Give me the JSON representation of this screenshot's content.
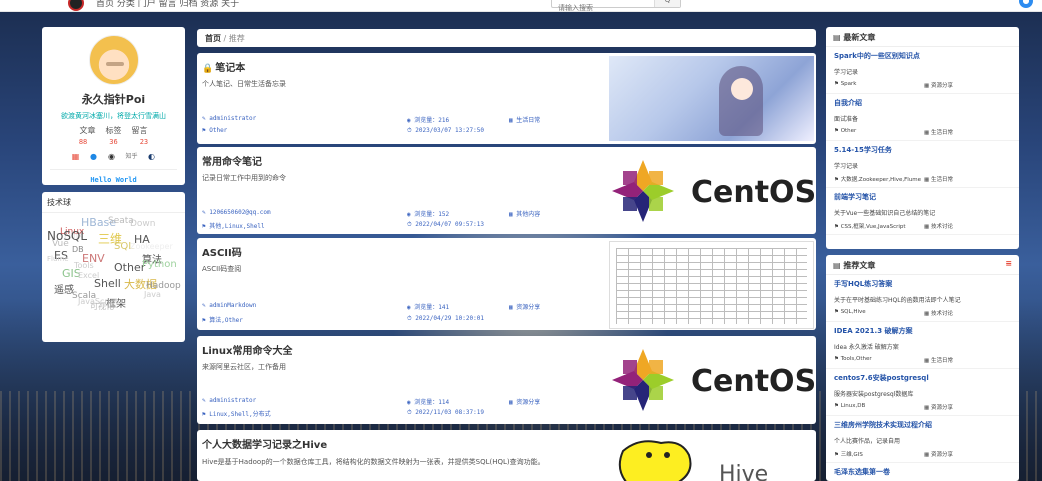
{
  "nav": {
    "items": "首页  分类  门户  留言  归档  资源  关于",
    "search_placeholder": "请输入搜索",
    "search_button": "Q"
  },
  "profile": {
    "name": "永久指针Poi",
    "motto": "欲渡黄河冰塞川，将登太行雪满山",
    "stats_labels": [
      "文章",
      "标签",
      "留言"
    ],
    "stats_values": [
      "88",
      "36",
      "23"
    ],
    "social_icons": [
      "calendar-icon",
      "qq-icon",
      "github-icon",
      "zhihu-icon",
      "steam-icon"
    ],
    "zhihu_label": "知乎",
    "hello": "Hello World"
  },
  "tagcloud": {
    "title": "技术球",
    "tags": [
      {
        "t": "HBase",
        "c": "#9fb7d6",
        "s": 11
      },
      {
        "t": "Seata",
        "c": "#bbb",
        "s": 9
      },
      {
        "t": "Linux",
        "c": "#c55",
        "s": 9
      },
      {
        "t": "Down",
        "c": "#ccc",
        "s": 9
      },
      {
        "t": "Flink",
        "c": "#ddd",
        "s": 8
      },
      {
        "t": "NoSQL",
        "c": "#555",
        "s": 12
      },
      {
        "t": "三维",
        "c": "#e0c84a",
        "s": 12
      },
      {
        "t": "HA",
        "c": "#555",
        "s": 11
      },
      {
        "t": "Vue",
        "c": "#bbb",
        "s": 9
      },
      {
        "t": "SQL",
        "c": "#d8c86a",
        "s": 10
      },
      {
        "t": "Zookeeper",
        "c": "#eee",
        "s": 8
      },
      {
        "t": "ES",
        "c": "#555",
        "s": 11
      },
      {
        "t": "DB",
        "c": "#888",
        "s": 8
      },
      {
        "t": "ENV",
        "c": "#c77",
        "s": 11
      },
      {
        "t": "算法",
        "c": "#555",
        "s": 10
      },
      {
        "t": "Tools",
        "c": "#ccc",
        "s": 8
      },
      {
        "t": "Flume",
        "c": "#ccc",
        "s": 7
      },
      {
        "t": "Other",
        "c": "#555",
        "s": 11
      },
      {
        "t": "Python",
        "c": "#9fd29f",
        "s": 10
      },
      {
        "t": "GIS",
        "c": "#8bc38b",
        "s": 11
      },
      {
        "t": "Excel",
        "c": "#ccc",
        "s": 8
      },
      {
        "t": "Shell",
        "c": "#555",
        "s": 11
      },
      {
        "t": "大数据",
        "c": "#d8b84a",
        "s": 11
      },
      {
        "t": "遥感",
        "c": "#555",
        "s": 10
      },
      {
        "t": "Hadoop",
        "c": "#999",
        "s": 9
      },
      {
        "t": "Java",
        "c": "#ccc",
        "s": 8
      },
      {
        "t": "Scala",
        "c": "#999",
        "s": 9
      },
      {
        "t": "框架",
        "c": "#555",
        "s": 10
      },
      {
        "t": "JavaScript",
        "c": "#ccc",
        "s": 8
      },
      {
        "t": "可视化",
        "c": "#bbb",
        "s": 8
      }
    ]
  },
  "breadcrumb": {
    "home": "首页",
    "sep": "/",
    "current": "推荐"
  },
  "posts": [
    {
      "title": "笔记本",
      "locked": true,
      "desc": "个人笔记、日常生活备忘录",
      "author": "administrator",
      "views": "浏览量：216",
      "category": "生活日常",
      "tags": "Other",
      "date": "2023/03/07 13:27:50",
      "thumb": "anime"
    },
    {
      "title": "常用命令笔记",
      "locked": false,
      "desc": "记录日常工作中用到的命令",
      "author": "1206650602@qq.com",
      "views": "浏览量：152",
      "category": "其他内容",
      "tags": "其他,Linux,Shell",
      "date": "2022/04/07 09:57:13",
      "thumb": "centos"
    },
    {
      "title": "ASCII码",
      "locked": false,
      "desc": "ASCII码查阅",
      "author": "adminMarkdown",
      "views": "浏览量：141",
      "category": "资源分享",
      "tags": "算法,Other",
      "date": "2022/04/29 10:20:01",
      "thumb": "ascii"
    },
    {
      "title": "Linux常用命令大全",
      "locked": false,
      "desc": "来源阿里云社区，工作备用",
      "author": "administrator",
      "views": "浏览量：114",
      "category": "资源分享",
      "tags": "Linux,Shell,分布式",
      "date": "2022/11/03 08:37:19",
      "thumb": "centos"
    },
    {
      "title": "个人大数据学习记录之Hive",
      "locked": false,
      "desc": "Hive是基于Hadoop的一个数据仓库工具，将结构化的数据文件映射为一张表，并提供类SQL(HQL)查询功能。",
      "author": "",
      "views": "",
      "category": "",
      "tags": "",
      "date": "",
      "thumb": "hive"
    }
  ],
  "centos_text": "CentOS",
  "hive_text": "Hive",
  "latest": {
    "title": "最新文章",
    "items": [
      {
        "title": "Spark中的一些区别知识点",
        "desc": "学习记录",
        "tags": "Spark",
        "category": "资源分享"
      },
      {
        "title": "自我介绍",
        "desc": "面试准备",
        "tags": "Other",
        "category": "生活日常"
      },
      {
        "title": "5.14-15学习任务",
        "desc": "学习记录",
        "tags": "大数据,Zookeeper,Hive,Flume",
        "category": "生活日常"
      },
      {
        "title": "前端学习笔记",
        "desc": "关于Vue一些基础知识自己总结的笔记",
        "tags": "CSS,框架,Vue,JavaScript",
        "category": "技术讨论"
      }
    ]
  },
  "recommend": {
    "title": "推荐文章",
    "items": [
      {
        "title": "手写HQL练习答案",
        "desc": "关于在平时基础练习HQL的函数用法即个人笔记",
        "tags": "SQL,Hive",
        "category": "技术讨论"
      },
      {
        "title": "IDEA 2021.3 破解方案",
        "desc": "Idea 永久激活 破解方案",
        "tags": "Tools,Other",
        "category": "生活日常"
      },
      {
        "title": "centos7.6安装postgresql",
        "desc": "服务器安装postgresql数据库",
        "tags": "Linux,DB",
        "category": "资源分享"
      },
      {
        "title": "三维房州学院技术实现过程介绍",
        "desc": "个人比赛作品，记录自用",
        "tags": "三维,GIS",
        "category": "资源分享"
      },
      {
        "title": "毛泽东选集第一卷",
        "desc": "",
        "tags": "",
        "category": ""
      }
    ]
  }
}
